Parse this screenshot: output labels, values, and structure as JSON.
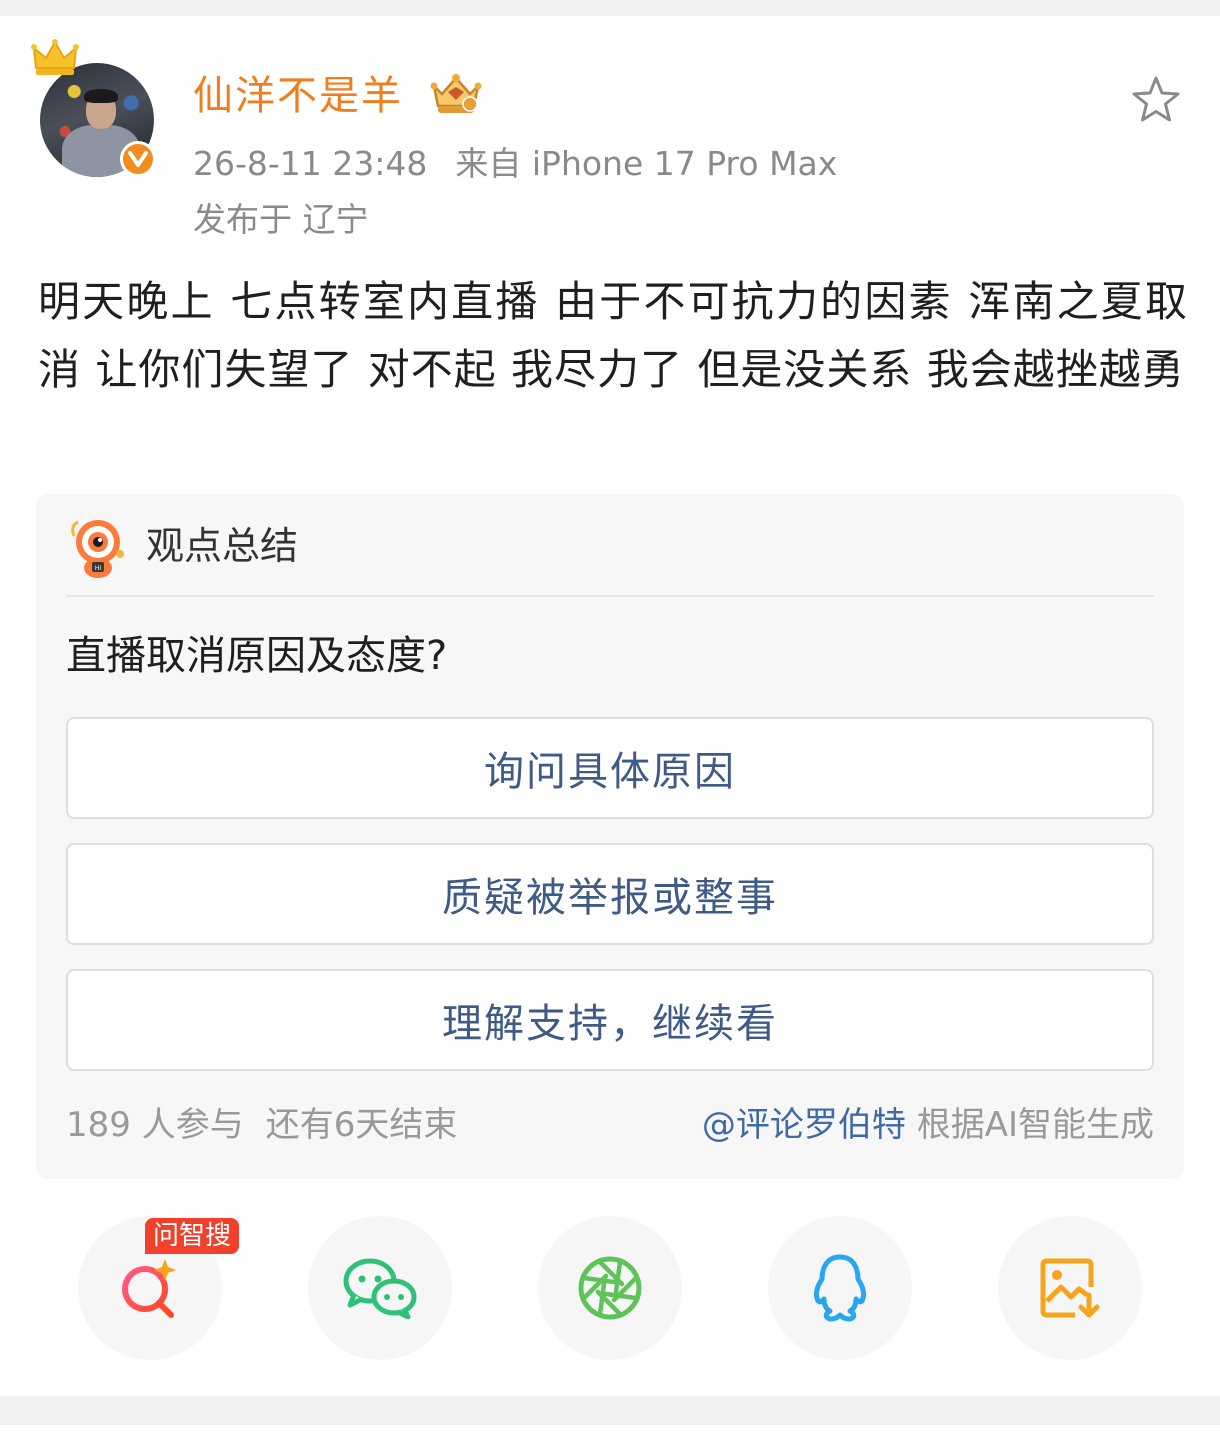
{
  "post": {
    "username": "仙洋不是羊",
    "timestamp": "26-8-11 23:48",
    "source": "来自 iPhone 17 Pro Max",
    "location": "发布于 辽宁",
    "text": "明天晚上 七点转室内直播 由于不可抗力的因素 浑南之夏取消 让你们失望了 对不起 我尽力了 但是没关系 我会越挫越勇",
    "favorite_icon": "star-outline-icon"
  },
  "poll": {
    "header_label": "观点总结",
    "question": "直播取消原因及态度?",
    "options": [
      {
        "label": "询问具体原因"
      },
      {
        "label": "质疑被举报或整事"
      },
      {
        "label": "理解支持，继续看"
      }
    ],
    "participants": "189 人参与",
    "remaining": "还有6天结束",
    "generator_mention": "@评论罗伯特",
    "generator_suffix": " 根据AI智能生成"
  },
  "share": {
    "ai_search_tag": "问智搜",
    "buttons": [
      {
        "icon": "ai-search-icon"
      },
      {
        "icon": "wechat-icon"
      },
      {
        "icon": "moments-icon"
      },
      {
        "icon": "qq-icon"
      },
      {
        "icon": "save-image-icon"
      }
    ]
  },
  "colors": {
    "username": "#f07e1d",
    "verified": "#f28c1e",
    "option_text": "#3e5a86",
    "mention": "#3e6aa8",
    "ai_tag": "#f1412d",
    "wechat": "#2fc177",
    "moments": "#5ec45a",
    "qq": "#2aa6f0",
    "save": "#f7a41d"
  }
}
